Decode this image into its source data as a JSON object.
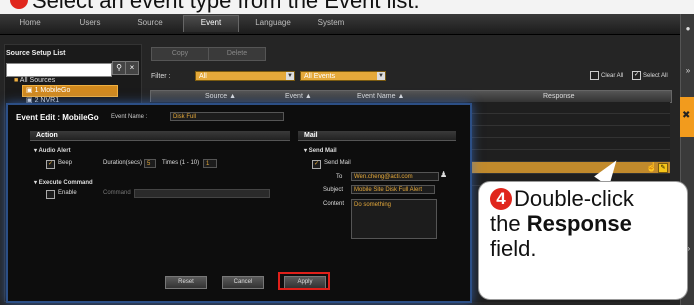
{
  "caption": {
    "text": "Select an event type from the Event list."
  },
  "nav": {
    "tabs": [
      "Home",
      "Users",
      "Source",
      "Event",
      "Language",
      "System"
    ],
    "active": "Event"
  },
  "source_panel": {
    "title": "Source Setup List",
    "search_placeholder": "",
    "tree": [
      "All Sources",
      "1 MobileGo",
      "2 NVR1"
    ]
  },
  "toolbar": {
    "copy_label": "Copy",
    "delete_label": "Delete"
  },
  "filter": {
    "label": "Filter :",
    "source_value": "All",
    "event_value": "All Events",
    "clear_all": "Clear All",
    "select_all": "Select All"
  },
  "grid": {
    "columns": [
      "Source",
      "Event",
      "Event Name",
      "Response"
    ]
  },
  "dialog": {
    "title": "Event Edit : MobileGo",
    "event_name_label": "Event Name :",
    "event_name_value": "Disk Full",
    "action": {
      "header": "Action",
      "audio_alert_label": "Audio Alert",
      "beep_label": "Beep",
      "duration_label": "Duration(secs)",
      "duration_value": "5",
      "times_label": "Times (1 - 10)",
      "times_value": "1",
      "execute_command_label": "Execute Command",
      "enable_label": "Enable",
      "command_label": "Command"
    },
    "mail": {
      "header": "Mail",
      "send_mail_section": "Send Mail",
      "send_mail_checkbox": "Send Mail",
      "to_label": "To",
      "to_value": "Wen.cheng@acti.com",
      "subject_label": "Subject",
      "subject_value": "Mobile Site Disk Full Alert",
      "content_label": "Content",
      "content_value": "Do something"
    },
    "buttons": {
      "reset": "Reset",
      "cancel": "Cancel",
      "apply": "Apply"
    }
  },
  "callout": {
    "step": "4",
    "line1": "Double-click",
    "line2_prefix": "the ",
    "line2_bold": "Response",
    "line3": "field."
  },
  "colors": {
    "accent": "#e5a93a",
    "highlight_red": "#e0201a",
    "dialog_border": "#2c4f86"
  }
}
